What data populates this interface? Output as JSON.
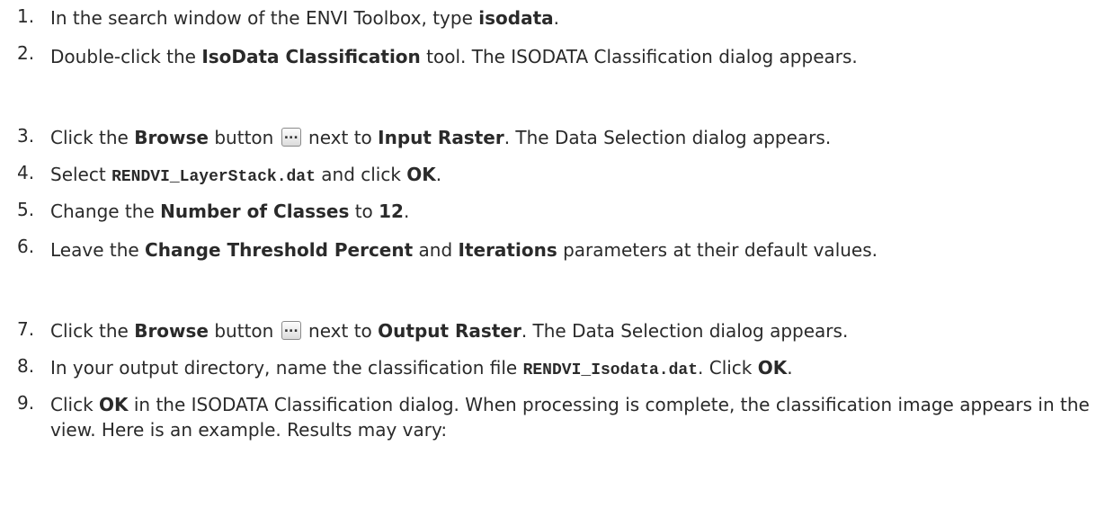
{
  "steps": [
    {
      "n": "1.",
      "parts": [
        "In the search window of the ENVI Toolbox, type ",
        "isodata",
        "."
      ]
    },
    {
      "n": "2.",
      "parts": [
        "Double-click the ",
        "IsoData Classification",
        " tool. The ISODATA Classification dialog appears."
      ]
    },
    {
      "n": "3.",
      "parts": [
        "Click the ",
        "Browse",
        " button ",
        " next to ",
        "Input Raster",
        ". The Data Selection dialog appears."
      ]
    },
    {
      "n": "4.",
      "parts": [
        "Select ",
        "RENDVI_LayerStack.dat",
        " and click ",
        "OK",
        "."
      ]
    },
    {
      "n": "5.",
      "parts": [
        "Change the ",
        "Number of Classes",
        " to ",
        "12",
        "."
      ]
    },
    {
      "n": "6.",
      "parts": [
        "Leave the ",
        "Change Threshold Percent",
        " and ",
        "Iterations",
        " parameters at their default values."
      ]
    },
    {
      "n": "7.",
      "parts": [
        "Click the ",
        "Browse",
        " button ",
        " next to ",
        "Output Raster",
        ". The Data Selection dialog appears."
      ]
    },
    {
      "n": "8.",
      "parts": [
        "In your output directory, name the classification file ",
        "RENDVI_Isodata.dat",
        ". Click ",
        "OK",
        "."
      ]
    },
    {
      "n": "9.",
      "parts": [
        "Click ",
        "OK",
        " in the ISODATA Classification dialog. When processing is complete, the classification image appears in the view. Here is an example. Results may vary:"
      ]
    }
  ],
  "icons": {
    "browse": "ellipsis-browse-icon"
  }
}
